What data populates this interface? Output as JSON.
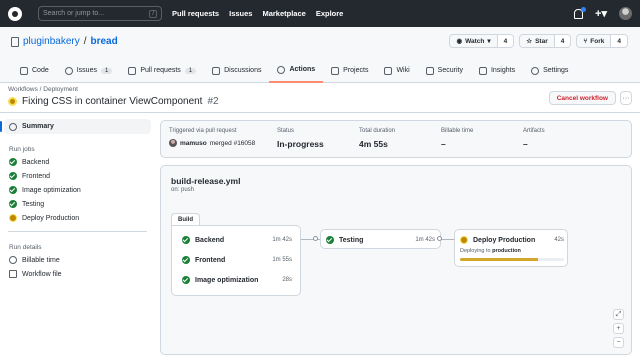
{
  "topbar": {
    "search_placeholder": "Search or jump to...",
    "search_key": "/",
    "nav": [
      "Pull requests",
      "Issues",
      "Marketplace",
      "Explore"
    ]
  },
  "repo": {
    "owner": "pluginbakery",
    "separator": "/",
    "name": "bread",
    "watch_label": "Watch",
    "watch_count": "4",
    "star_label": "Star",
    "star_count": "4",
    "fork_label": "Fork",
    "fork_count": "4"
  },
  "tabs": [
    {
      "label": "Code",
      "icon": "code-icon"
    },
    {
      "label": "Issues",
      "count": "1",
      "icon": "issue-icon"
    },
    {
      "label": "Pull requests",
      "count": "1",
      "icon": "pull-request-icon"
    },
    {
      "label": "Discussions",
      "icon": "discussion-icon"
    },
    {
      "label": "Actions",
      "icon": "play-icon",
      "active": true
    },
    {
      "label": "Projects",
      "icon": "project-icon"
    },
    {
      "label": "Wiki",
      "icon": "book-icon"
    },
    {
      "label": "Security",
      "icon": "shield-icon"
    },
    {
      "label": "Insights",
      "icon": "graph-icon"
    },
    {
      "label": "Settings",
      "icon": "gear-icon"
    }
  ],
  "run": {
    "breadcrumb": "Workflows / Deployment",
    "title": "Fixing CSS in container ViewComponent",
    "number": "#2",
    "cancel_label": "Cancel workflow",
    "more_label": "···"
  },
  "sidebar": {
    "summary": "Summary",
    "run_jobs_heading": "Run jobs",
    "jobs": [
      {
        "label": "Backend",
        "status": "success"
      },
      {
        "label": "Frontend",
        "status": "success"
      },
      {
        "label": "Image optimization",
        "status": "success"
      },
      {
        "label": "Testing",
        "status": "success"
      },
      {
        "label": "Deploy Production",
        "status": "in_progress"
      }
    ],
    "run_details_heading": "Run details",
    "details": [
      {
        "label": "Billable time",
        "icon": "clock-icon"
      },
      {
        "label": "Workflow file",
        "icon": "file-icon"
      }
    ]
  },
  "summary": {
    "trigger_label": "Triggered via pull request",
    "trigger_user": "mamuso",
    "trigger_text": "merged #16058",
    "status_label": "Status",
    "status_value": "In-progress",
    "duration_label": "Total duration",
    "duration_value": "4m 55s",
    "billable_label": "Billable time",
    "billable_value": "–",
    "artifacts_label": "Artifacts",
    "artifacts_value": "–"
  },
  "graph": {
    "workflow_file": "build-release.yml",
    "trigger": "on: push",
    "group_label": "Build",
    "build_jobs": [
      {
        "name": "Backend",
        "duration": "1m 42s"
      },
      {
        "name": "Frontend",
        "duration": "1m 55s"
      },
      {
        "name": "Image optimization",
        "duration": "28s"
      }
    ],
    "testing": {
      "name": "Testing",
      "duration": "1m 42s"
    },
    "deploy": {
      "name": "Deploy Production",
      "duration": "42s",
      "sub_prefix": "Deploying to",
      "sub_target": "production",
      "progress": 0.75
    },
    "zoom_controls": [
      "⤢",
      "+",
      "−"
    ]
  },
  "colors": {
    "success": "#1a7f37",
    "in_progress": "#bf8700",
    "danger": "#cf222e",
    "link": "#0969da",
    "header_bg": "#24292f"
  }
}
